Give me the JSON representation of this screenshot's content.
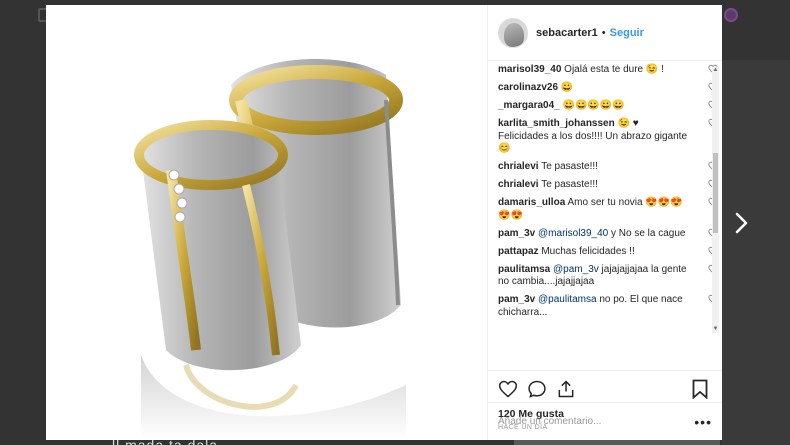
{
  "header": {
    "username": "sebacarter1",
    "separator": "•",
    "follow_label": "Seguir"
  },
  "comments": [
    {
      "user": "marisol39_40",
      "text": "Ojalá esta te dure 😉 !"
    },
    {
      "user": "carolinazv26",
      "text": "😀"
    },
    {
      "user": "_margara04_",
      "text": "😀😀😀😀😀"
    },
    {
      "user": "karlita_smith_johanssen",
      "text": "😉 ♥ Felicidades a los dos!!!! Un abrazo gigante 😊"
    },
    {
      "user": "chrialevi",
      "text": "Te pasaste!!!"
    },
    {
      "user": "chrialevi",
      "text": "Te pasaste!!!"
    },
    {
      "user": "damaris_ulloa",
      "text": "Amo ser tu novia 😍😍😍😍😍"
    },
    {
      "user": "pam_3v",
      "mention": "@marisol39_40",
      "text": " y No se la cague"
    },
    {
      "user": "pattapaz",
      "text": "Muchas felicidades !!"
    },
    {
      "user": "paulitamsa",
      "mention": "@pam_3v",
      "text": " jajajajjajaa la gente no cambia....jajajjajaa"
    },
    {
      "user": "pam_3v",
      "mention": "@paulitamsa",
      "text": " no po. El que nace chicharra..."
    }
  ],
  "actions": {
    "like_icon": "heart-outline-icon",
    "comment_icon": "comment-bubble-icon",
    "share_icon": "share-upload-icon",
    "save_icon": "bookmark-icon"
  },
  "likes_text": "120 Me gusta",
  "timestamp": "HACE UN DÍA",
  "add_comment": {
    "placeholder": "Añade un comentario...",
    "more_label": "•••"
  },
  "background": {
    "caption_fragment": "ll mada ta dala"
  },
  "colors": {
    "accent": "#3897f0",
    "mention": "#003569",
    "gold": "#c9a83a",
    "silver": "#b9b9b9"
  }
}
